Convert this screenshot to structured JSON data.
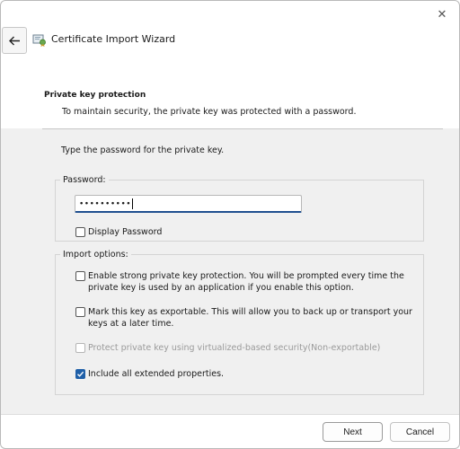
{
  "window": {
    "title": "Certificate Import Wizard",
    "close_glyph": "✕",
    "back_glyph": "←"
  },
  "header": {
    "section_title": "Private key protection",
    "section_description": "To maintain security, the private key was protected with a password."
  },
  "password_section": {
    "instruction": "Type the password for the private key.",
    "group_label": "Password:",
    "password_masked": "••••••••••",
    "display_password": {
      "label": "Display Password",
      "checked": false
    }
  },
  "import_options": {
    "group_label": "Import options:",
    "options": [
      {
        "line1": "Enable strong private key protection. You will be prompted every time the",
        "line2": "private key is used by an application if you enable this option.",
        "checked": false,
        "enabled": true
      },
      {
        "line1": "Mark this key as exportable. This will allow you to back up or transport your",
        "line2": "keys at a later time.",
        "checked": false,
        "enabled": true
      },
      {
        "line1": "Protect private key using virtualized-based security(Non-exportable)",
        "line2": "",
        "checked": false,
        "enabled": false
      },
      {
        "line1": "Include all extended properties.",
        "line2": "",
        "checked": true,
        "enabled": true
      }
    ]
  },
  "buttons": {
    "next": "Next",
    "cancel": "Cancel"
  },
  "colors": {
    "accent": "#1f5fa8",
    "content_bg": "#f0f0f0"
  }
}
